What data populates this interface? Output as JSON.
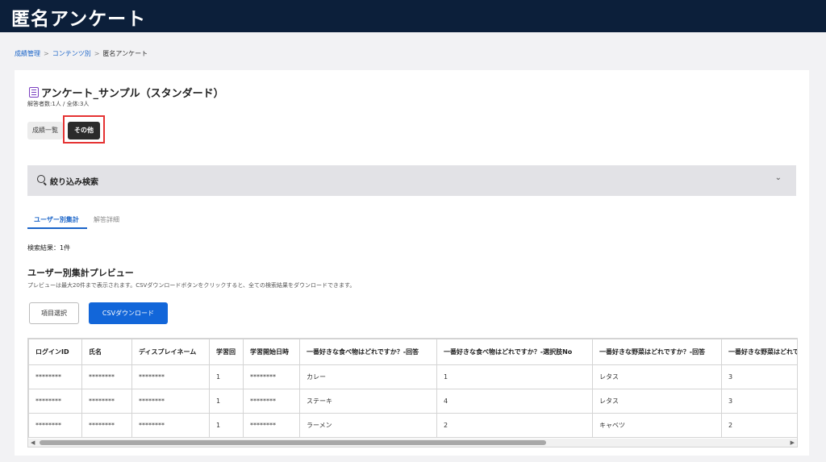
{
  "header": {
    "title": "匿名アンケート"
  },
  "breadcrumb": {
    "items": [
      "成績管理",
      "コンテンツ別",
      "匿名アンケート"
    ]
  },
  "survey": {
    "title": "アンケート_サンプル（スタンダード）",
    "response_count": "解答者数:1人 / 全体:3人"
  },
  "tabs": {
    "grades": "成績一覧",
    "other": "その他"
  },
  "filter": {
    "label": "絞り込み検索"
  },
  "subtabs": {
    "user_summary": "ユーザー別集計",
    "answer_detail": "解答詳細"
  },
  "results": {
    "text": "検索結果：1件"
  },
  "preview": {
    "heading": "ユーザー別集計プレビュー",
    "note": "プレビューは最大20件まで表示されます。CSVダウンロードボタンをクリックすると、全ての検索結果をダウンロードできます。"
  },
  "buttons": {
    "item_select": "項目選択",
    "csv_download": "CSVダウンロード"
  },
  "table": {
    "headers": [
      "ログインID",
      "氏名",
      "ディスプレイネーム",
      "学習回",
      "学習開始日時",
      "一番好きな食べ物はどれですか？-回答",
      "一番好きな食べ物はどれですか？-選択肢No",
      "一番好きな野菜はどれですか？-回答",
      "一番好きな野菜はどれですか？-選択肢No"
    ],
    "rows": [
      [
        "********",
        "********",
        "********",
        "1",
        "********",
        "カレー",
        "1",
        "レタス",
        "3"
      ],
      [
        "********",
        "********",
        "********",
        "1",
        "********",
        "ステーキ",
        "4",
        "レタス",
        "3"
      ],
      [
        "********",
        "********",
        "********",
        "1",
        "********",
        "ラーメン",
        "2",
        "キャベツ",
        "2"
      ]
    ]
  },
  "scroll": {
    "left_arrow": "◀",
    "right_arrow": "▶"
  },
  "icons": {
    "search": "search-icon",
    "chevron": "chevron-down-icon",
    "survey": "survey-icon"
  },
  "colors": {
    "header_bg": "#0c1f3a",
    "accent": "#1266d9",
    "highlight": "#e53333"
  }
}
